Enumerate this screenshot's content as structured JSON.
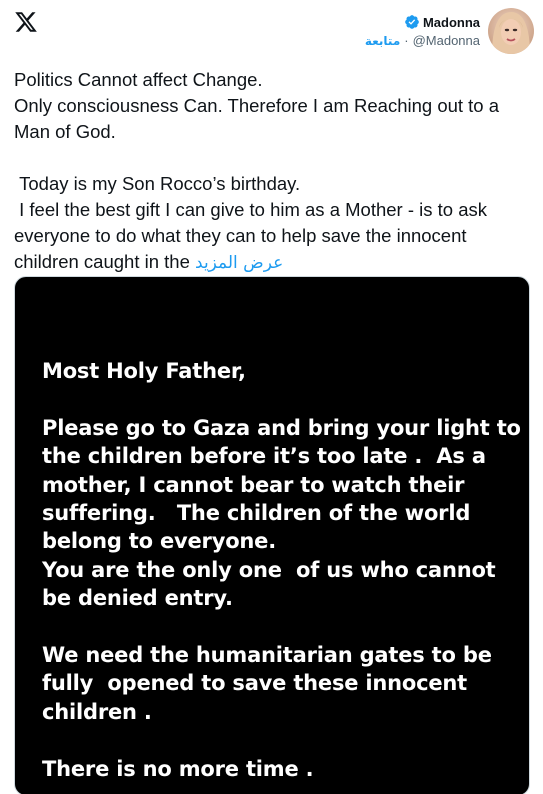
{
  "app": {
    "logo_icon": "x-logo-icon"
  },
  "author": {
    "display_name": "Madonna",
    "verified_icon": "verified-badge-icon",
    "handle": "@Madonna",
    "separator": "·",
    "follow_label": "متابعة",
    "avatar_icon": "profile-avatar"
  },
  "tweet": {
    "text": "Politics Cannot affect Change.\nOnly consciousness Can. Therefore I am Reaching out to a Man of God.\n\n Today is my Son Rocco’s birthday.\n I feel the best gift I can give to him as a Mother - is to ask everyone to do what they can to help save the innocent children caught in the ",
    "show_more_label": "عرض المزيد"
  },
  "media": {
    "letter_text": "Most Holy Father,\n\nPlease go to Gaza and bring your light to the children before it’s too late .  As a mother, I cannot bear to watch their suffering.   The children of the world belong to everyone.\nYou are the only one  of us who cannot be denied entry.\n\nWe need the humanitarian gates to be  fully  opened to save these innocent children .\n\nThere is no more time ."
  },
  "colors": {
    "accent": "#1d9bf0",
    "text": "#0f1419",
    "secondary": "#536471",
    "media_bg": "#000000"
  }
}
